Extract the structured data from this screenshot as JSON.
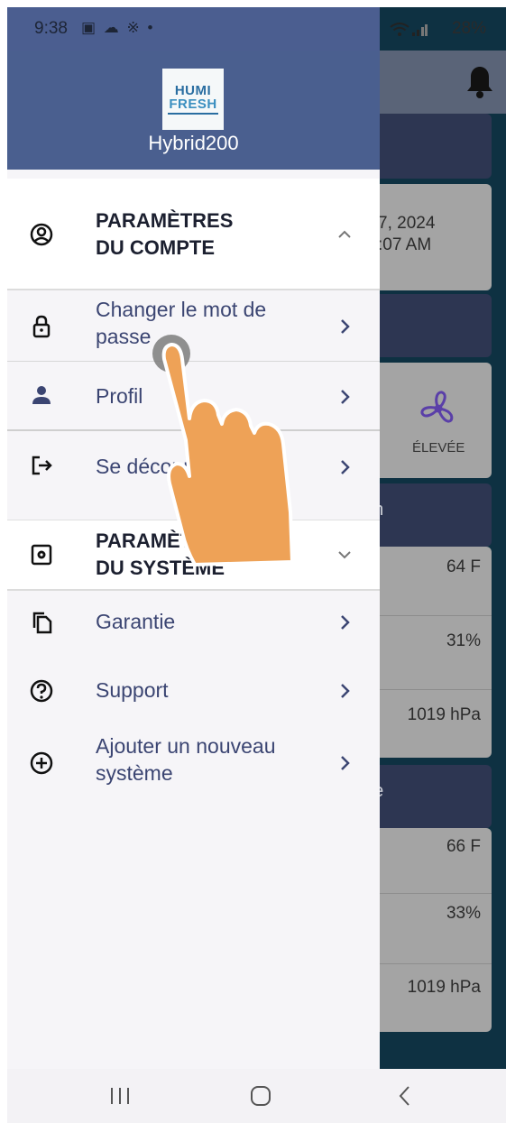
{
  "status_bar": {
    "time": "9:38",
    "icons": "▣ ☁ ※ •",
    "right": "28%"
  },
  "drawer": {
    "logo": {
      "line1": "HUMI",
      "line2": "FRESH"
    },
    "device_name": "Hybrid200",
    "account_section": {
      "title_line1": "PARAMÈTRES",
      "title_line2": "DU COMPTE"
    },
    "account_items": [
      {
        "label_line1": "Changer le mot de",
        "label_line2": "passe",
        "icon": "lock-icon"
      },
      {
        "label": "Profil",
        "icon": "person-icon"
      },
      {
        "label": "Se déconnecter",
        "icon": "logout-icon"
      }
    ],
    "system_section": {
      "title_line1": "PARAMÈTRES",
      "title_line2": "DU SYSTÈME"
    },
    "system_items": [
      {
        "label": "Garantie",
        "icon": "copy-icon"
      },
      {
        "label": "Support",
        "icon": "help-icon"
      },
      {
        "label_line1": "Ajouter un nouveau",
        "label_line2": "système",
        "icon": "add-circle-icon"
      }
    ]
  },
  "background": {
    "date_line1": "7, 2024",
    "date_line2": ":07 AM",
    "fan_label": "ÉLEVÉE",
    "section1_title": "on",
    "section1_values": [
      "64 F",
      "31%",
      "1019 hPa"
    ],
    "section2_title": "ire",
    "section2_values": [
      "66 F",
      "33%",
      "1019 hPa"
    ]
  },
  "colors": {
    "drawer_header": "#4a5f8f",
    "accent_text": "#3b4572",
    "background_dark": "#0e3142"
  }
}
